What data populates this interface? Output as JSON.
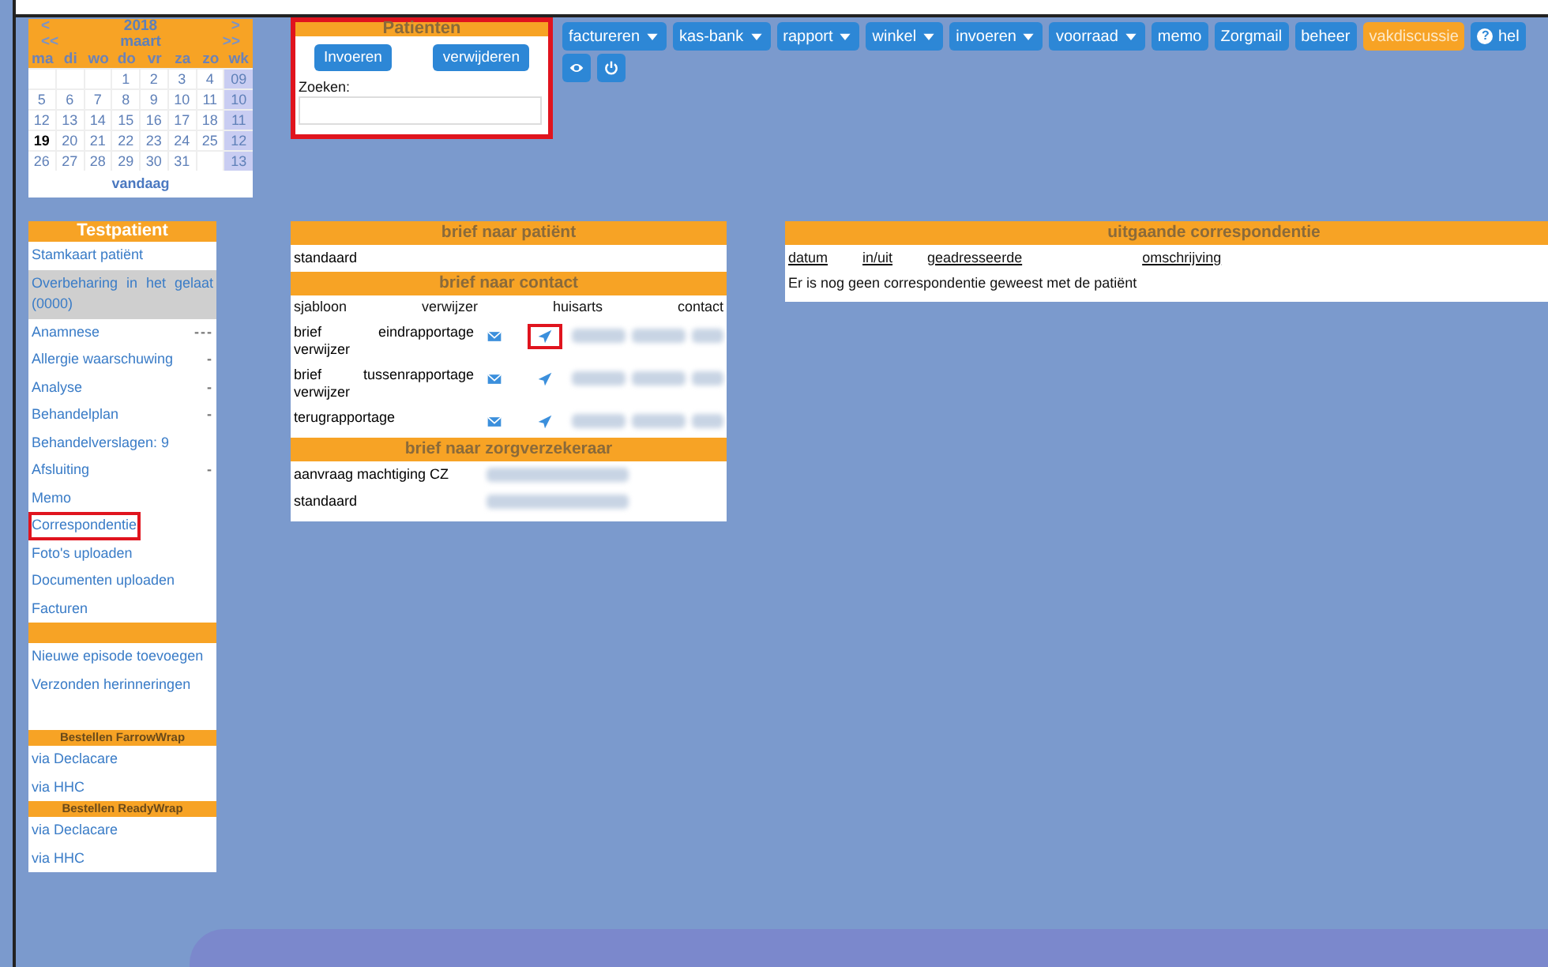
{
  "calendar": {
    "prev_year": "<",
    "year": "2018",
    "next_year": ">",
    "prev_month": "<<",
    "month": "maart",
    "next_month": ">>",
    "weekdays": [
      "ma",
      "di",
      "wo",
      "do",
      "vr",
      "za",
      "zo",
      "wk"
    ],
    "weeks": [
      {
        "week": "09",
        "kind": "first",
        "days": [
          {
            "label": "1",
            "selected": false
          },
          {
            "label": "2",
            "selected": false
          },
          {
            "label": "3",
            "selected": false
          },
          {
            "label": "4",
            "selected": false
          }
        ]
      },
      {
        "week": "10",
        "kind": "middle",
        "days": [
          {
            "label": "5",
            "selected": false
          },
          {
            "label": "6",
            "selected": false
          },
          {
            "label": "7",
            "selected": false
          },
          {
            "label": "8",
            "selected": false
          },
          {
            "label": "9",
            "selected": false
          },
          {
            "label": "10",
            "selected": false
          },
          {
            "label": "11",
            "selected": false
          }
        ]
      },
      {
        "week": "11",
        "kind": "middle",
        "days": [
          {
            "label": "12",
            "selected": false
          },
          {
            "label": "13",
            "selected": false
          },
          {
            "label": "14",
            "selected": false
          },
          {
            "label": "15",
            "selected": false
          },
          {
            "label": "16",
            "selected": false
          },
          {
            "label": "17",
            "selected": false
          },
          {
            "label": "18",
            "selected": false
          }
        ]
      },
      {
        "week": "12",
        "kind": "middle",
        "days": [
          {
            "label": "19",
            "selected": true
          },
          {
            "label": "20",
            "selected": false
          },
          {
            "label": "21",
            "selected": false
          },
          {
            "label": "22",
            "selected": false
          },
          {
            "label": "23",
            "selected": false
          },
          {
            "label": "24",
            "selected": false
          },
          {
            "label": "25",
            "selected": false
          }
        ]
      },
      {
        "week": "13",
        "kind": "last",
        "days": [
          {
            "label": "26",
            "selected": false
          },
          {
            "label": "27",
            "selected": false
          },
          {
            "label": "28",
            "selected": false
          },
          {
            "label": "29",
            "selected": false
          },
          {
            "label": "30",
            "selected": false
          },
          {
            "label": "31",
            "selected": false
          }
        ]
      }
    ],
    "today": "vandaag"
  },
  "patients": {
    "title": "Patienten",
    "highlighted": true,
    "add_button": "Invoeren",
    "delete_button": "verwijderen",
    "search_label": "Zoeken:"
  },
  "nav": {
    "buttons": [
      {
        "label": "factureren",
        "kind": "menu",
        "dropdown": true
      },
      {
        "label": "kas-bank",
        "kind": "menu",
        "dropdown": true
      },
      {
        "label": "rapport",
        "kind": "menu",
        "dropdown": true
      },
      {
        "label": "winkel",
        "kind": "menu",
        "dropdown": true
      },
      {
        "label": "invoeren",
        "kind": "menu",
        "dropdown": true
      },
      {
        "label": "voorraad",
        "kind": "menu",
        "dropdown": true
      },
      {
        "label": "memo",
        "kind": "menu",
        "dropdown": false
      },
      {
        "label": "Zorgmail",
        "kind": "menu",
        "dropdown": false
      },
      {
        "label": "beheer",
        "kind": "menu",
        "dropdown": false
      },
      {
        "label": "vakdiscussie",
        "kind": "accent",
        "dropdown": false
      },
      {
        "label": "hel",
        "kind": "help",
        "icon": "?",
        "dropdown": false
      }
    ],
    "icon_buttons": [
      {
        "kind": "eye"
      },
      {
        "kind": "power"
      }
    ]
  },
  "sidebar": {
    "rows": [
      {
        "kind": "header",
        "label": "Testpatient"
      },
      {
        "kind": "item",
        "label": "Stamkaart patiënt",
        "selected": false,
        "highlighted": false
      },
      {
        "kind": "item",
        "label": "Overbeharing in het gelaat (0000)",
        "selected": true,
        "highlighted": false
      },
      {
        "kind": "item",
        "label": "Anamnese",
        "marker": "---",
        "selected": false,
        "highlighted": false
      },
      {
        "kind": "item",
        "label": "Allergie waarschuwing",
        "marker": "-",
        "selected": false,
        "highlighted": false
      },
      {
        "kind": "item",
        "label": "Analyse",
        "marker": "-",
        "selected": false,
        "highlighted": false
      },
      {
        "kind": "item",
        "label": "Behandelplan",
        "marker": "-",
        "selected": false,
        "highlighted": false
      },
      {
        "kind": "item",
        "label": "Behandelverslagen: 9",
        "selected": false,
        "highlighted": false
      },
      {
        "kind": "item",
        "label": "Afsluiting",
        "marker": "-",
        "selected": false,
        "highlighted": false
      },
      {
        "kind": "item",
        "label": "Memo",
        "selected": false,
        "highlighted": false
      },
      {
        "kind": "item",
        "label": "Correspondentie",
        "selected": false,
        "highlighted": true
      },
      {
        "kind": "item",
        "label": "Foto's uploaden",
        "selected": false,
        "highlighted": false
      },
      {
        "kind": "item",
        "label": "Documenten uploaden",
        "selected": false,
        "highlighted": false
      },
      {
        "kind": "item",
        "label": "Facturen",
        "selected": false,
        "highlighted": false
      },
      {
        "kind": "divider"
      },
      {
        "kind": "item",
        "label": "Nieuwe episode toevoegen",
        "selected": false,
        "highlighted": false
      },
      {
        "kind": "item",
        "label": "Verzonden herinneringen",
        "selected": false,
        "highlighted": false
      },
      {
        "kind": "spacer"
      },
      {
        "kind": "subheader",
        "label": "Bestellen FarrowWrap"
      },
      {
        "kind": "item",
        "label": "via Declacare",
        "selected": false,
        "highlighted": false
      },
      {
        "kind": "item",
        "label": "via HHC",
        "selected": false,
        "highlighted": false
      },
      {
        "kind": "subheader",
        "label": "Bestellen ReadyWrap"
      },
      {
        "kind": "item",
        "label": "via Declacare",
        "selected": false,
        "highlighted": false
      },
      {
        "kind": "item",
        "label": "via HHC",
        "selected": false,
        "highlighted": false
      }
    ]
  },
  "letters": {
    "sections": [
      {
        "kind": "plain",
        "title": "brief naar patiënt",
        "rows": [
          {
            "label": "standaard"
          }
        ]
      },
      {
        "kind": "contact",
        "title": "brief naar contact",
        "columns": [
          "sjabloon",
          "verwijzer",
          "huisarts",
          "contact"
        ],
        "rows": [
          {
            "label": "brief eindrapportage verwijzer",
            "send_highlighted": true
          },
          {
            "label": "brief tussenrapportage verwijzer",
            "send_highlighted": false
          },
          {
            "label": "terugrapportage",
            "send_highlighted": false
          }
        ]
      },
      {
        "kind": "insurer",
        "title": "brief naar zorgverzekeraar",
        "rows": [
          {
            "label": "aanvraag machtiging CZ"
          },
          {
            "label": "standaard"
          }
        ]
      }
    ]
  },
  "outgoing": {
    "title": "uitgaande correspondentie",
    "columns": [
      "datum",
      "in/uit",
      "geadresseerde",
      "omschrijving"
    ],
    "message": "Er is nog geen correspondentie geweest met de patiënt"
  }
}
